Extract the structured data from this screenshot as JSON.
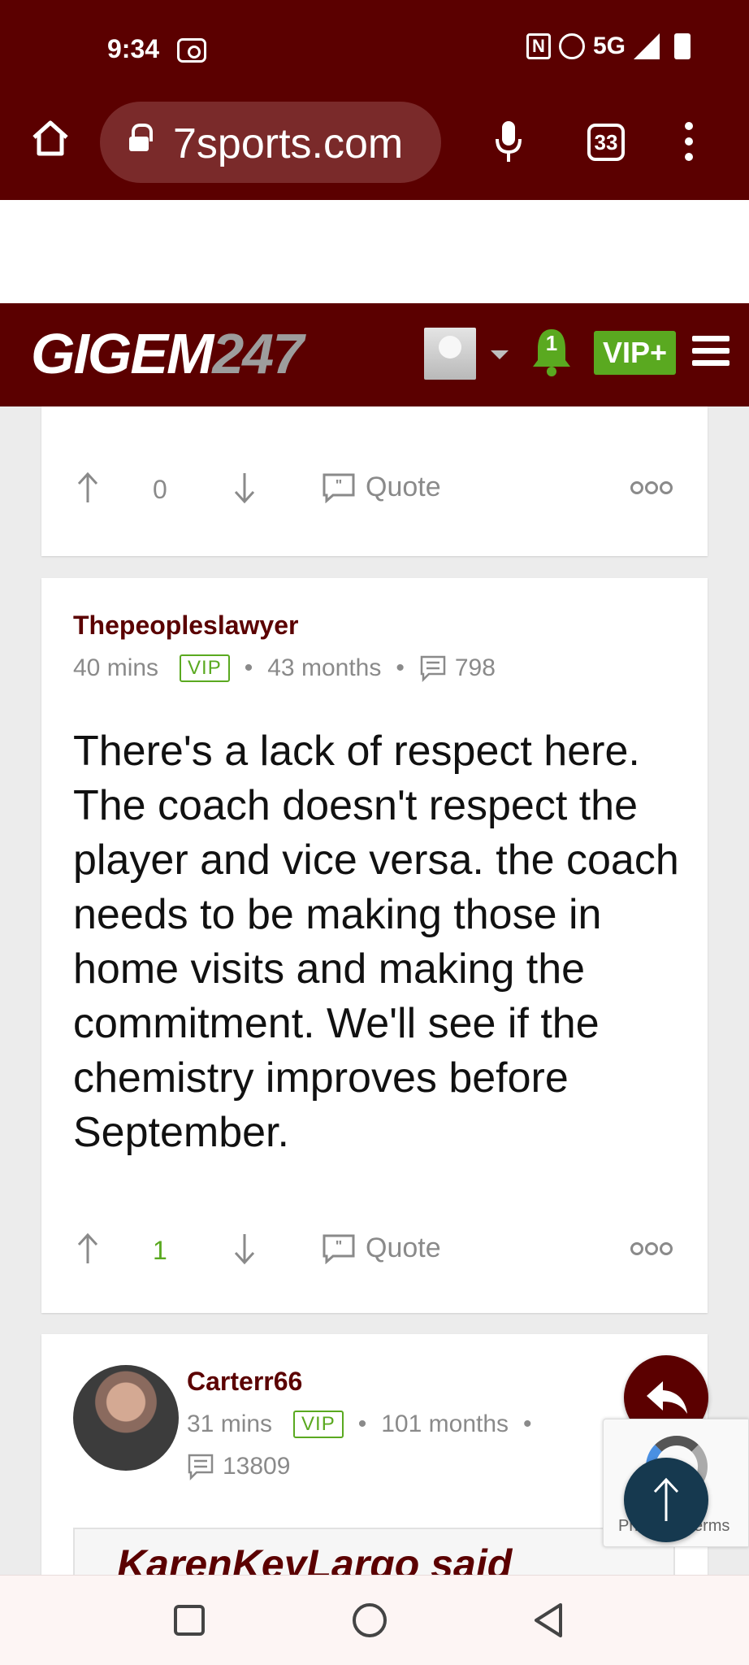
{
  "status_bar": {
    "time": "9:34",
    "network": "5G",
    "icons": [
      "cast-icon",
      "nfc-icon",
      "alarm-icon",
      "signal-icon",
      "battery-icon"
    ]
  },
  "browser": {
    "url": "7sports.com",
    "tab_count": "33"
  },
  "site_header": {
    "logo_main": "GIGEM",
    "logo_suffix": "247",
    "notification_count": "1",
    "vip_label": "VIP+",
    "colors": {
      "header_bg": "#5b0000",
      "vip_green": "#5aa920",
      "logo_gray": "#9d9d9d"
    }
  },
  "posts": [
    {
      "votes": "0",
      "quote_label": "Quote"
    },
    {
      "author": "Thepeopleslawyer",
      "time_ago": "40 mins",
      "badge": "VIP",
      "member_for": "43 months",
      "post_count": "798",
      "body": "There's a lack of respect here. The coach doesn't respect the player and vice versa. the coach needs to be making those in home visits and making the commitment. We'll see if the chemistry improves before September.",
      "votes": "1",
      "quote_label": "Quote"
    },
    {
      "author": "Carterr66",
      "time_ago": "31 mins",
      "badge": "VIP",
      "member_for": "101 months",
      "post_count": "13809",
      "quoted_author": "KarenKeyLargo said"
    }
  ],
  "recaptcha": {
    "text": "Privacy - Terms"
  }
}
